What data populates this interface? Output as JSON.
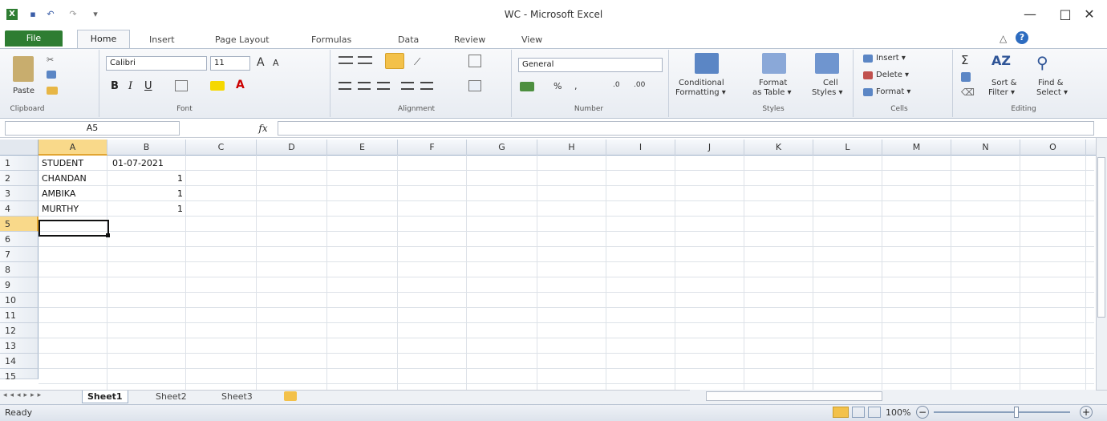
{
  "window": {
    "title": "WC - Microsoft Excel",
    "minimize": "—",
    "maximize": "□",
    "close": "✕"
  },
  "tabs": [
    "File",
    "Home",
    "Insert",
    "Page Layout",
    "Formulas",
    "Data",
    "Review",
    "View"
  ],
  "ribbon": {
    "clipboard": {
      "paste": "Paste",
      "label": "Clipboard"
    },
    "font": {
      "name": "Calibri",
      "size": "11",
      "label": "Font"
    },
    "alignment": {
      "label": "Alignment"
    },
    "number": {
      "format": "General",
      "label": "Number"
    },
    "styles": {
      "conditional": "Conditional",
      "conditional2": "Formatting ▾",
      "format_table": "Format",
      "format_table2": "as Table ▾",
      "cell_styles": "Cell",
      "cell_styles2": "Styles ▾",
      "label": "Styles"
    },
    "cells": {
      "insert": "Insert ▾",
      "delete": "Delete ▾",
      "format": "Format ▾",
      "label": "Cells"
    },
    "editing": {
      "sort": "Sort &",
      "sort2": "Filter ▾",
      "find": "Find &",
      "find2": "Select ▾",
      "label": "Editing"
    }
  },
  "formula_bar": {
    "name_box": "A5",
    "fx": "fx",
    "value": ""
  },
  "columns": [
    "A",
    "B",
    "C",
    "D",
    "E",
    "F",
    "G",
    "H",
    "I",
    "J",
    "K",
    "L",
    "M",
    "N",
    "O"
  ],
  "rows": [
    "1",
    "2",
    "3",
    "4",
    "5",
    "6",
    "7",
    "8",
    "9",
    "10",
    "11",
    "12",
    "13",
    "14",
    "15"
  ],
  "cells": {
    "A1": "STUDENT",
    "B1": "01-07-2021",
    "A2": "CHANDAN",
    "B2": "1",
    "A3": "AMBIKA",
    "B3": "1",
    "A4": "MURTHY",
    "B4": "1"
  },
  "sheets": [
    "Sheet1",
    "Sheet2",
    "Sheet3"
  ],
  "status": {
    "ready": "Ready",
    "zoom": "100%"
  }
}
